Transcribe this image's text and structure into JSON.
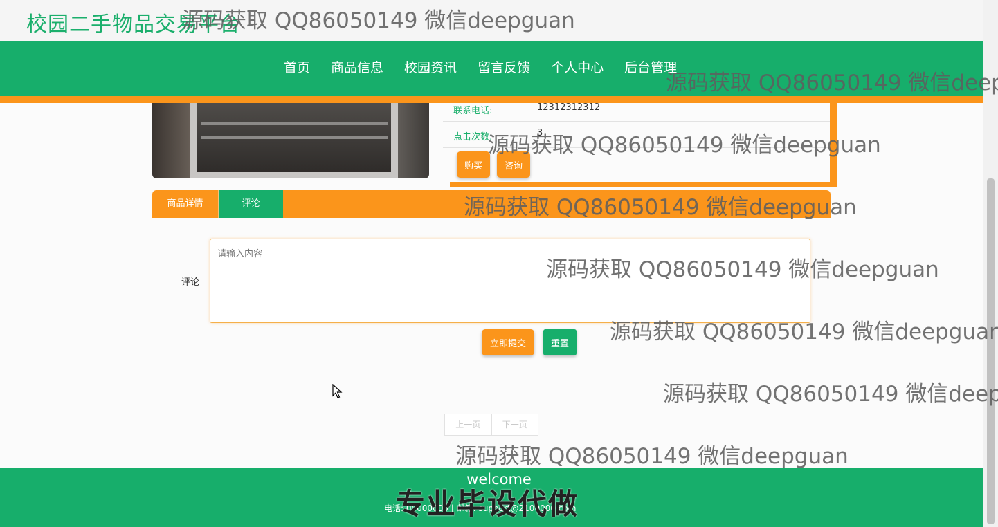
{
  "site": {
    "title": "校园二手物品交易平台"
  },
  "nav": {
    "items": [
      "首页",
      "商品信息",
      "校园资讯",
      "留言反馈",
      "个人中心",
      "后台管理"
    ]
  },
  "product": {
    "phone_label": "联系电话:",
    "phone_value": "12312312312",
    "clicks_label": "点击次数:",
    "clicks_value": "3",
    "buy_label": "购买",
    "consult_label": "咨询"
  },
  "tabs": {
    "detail": "商品详情",
    "comment": "评论"
  },
  "comment_form": {
    "label": "评论",
    "placeholder": "请输入内容",
    "submit_label": "立即提交",
    "reset_label": "重置"
  },
  "pagination": {
    "prev": "上一页",
    "next": "下一页"
  },
  "footer": {
    "welcome": "welcome",
    "contact": "电话: 00000000 | 邮箱: support@2100000.com",
    "stamp": "专业毕设代做"
  },
  "watermark": "源码获取 QQ86050149 微信deepguan",
  "colors": {
    "green": "#17ae6b",
    "orange": "#fb951b"
  }
}
